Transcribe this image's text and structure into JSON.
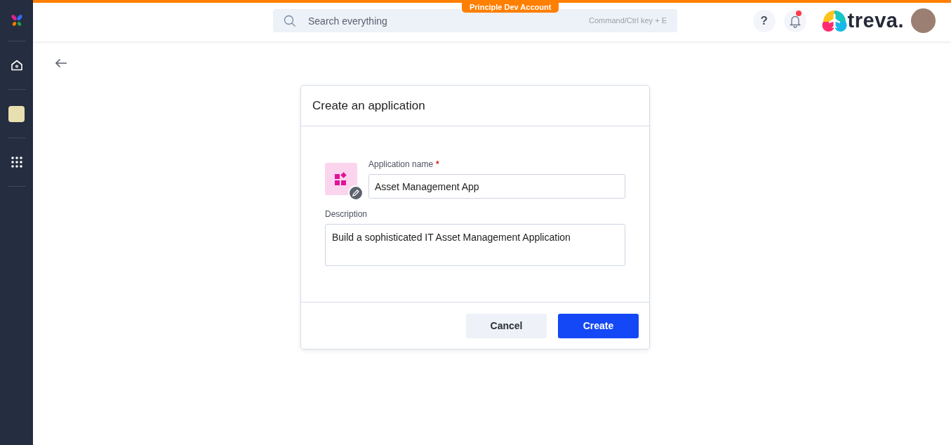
{
  "topbar": {
    "account_badge": "Principle Dev Account",
    "search": {
      "placeholder": "Search everything",
      "shortcut": "Command/Ctrl key + E"
    },
    "help": "?",
    "notifications": {
      "unread": true
    },
    "brand": "treva."
  },
  "sidebar": {
    "items": [
      {
        "kind": "home"
      },
      {
        "kind": "app"
      },
      {
        "kind": "apps"
      }
    ]
  },
  "dialog": {
    "title": "Create an application",
    "name_field": {
      "label": "Application name",
      "required": true,
      "required_mark": "*",
      "value": "Asset Management App"
    },
    "description_field": {
      "label": "Description",
      "value": "Build a sophisticated IT Asset Management Application"
    },
    "buttons": [
      {
        "label": "Cancel",
        "kind": "secondary"
      },
      {
        "label": "Create",
        "kind": "primary"
      }
    ]
  }
}
